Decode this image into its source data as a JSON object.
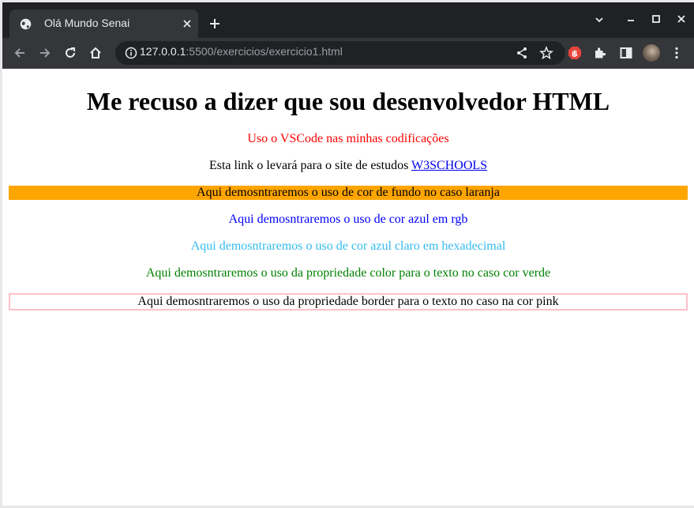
{
  "tab": {
    "title": "Olá Mundo Senai"
  },
  "address_bar": {
    "host": "127.0.0.1",
    "rest": ":5500/exercicios/exercicio1.html"
  },
  "page": {
    "heading": "Me recuso a dizer que sou desenvolvedor HTML",
    "vscode_text": "Uso o VSCode nas minhas codificações",
    "link_prefix": "Esta link o levará para o site de estudos ",
    "link_text": "W3SCHOOLS",
    "orange_text": "Aqui demosntraremos o uso de cor de fundo no caso laranja",
    "rgb_text": "Aqui demosntraremos o uso de cor azul em rgb",
    "hex_text": "Aqui demosntraremos o uso de cor azul claro em hexadecimal",
    "green_text": "Aqui demosntraremos o uso da propriedade color para o texto no caso cor verde",
    "border_text": "Aqui demosntraremos o uso da propriedade border para o texto no caso na cor pink"
  },
  "colors": {
    "red": "#ff0000",
    "rgb_blue": "#0000ff",
    "light_blue": "#33bbee",
    "green": "#008000",
    "orange": "#ffa500",
    "pink": "#ffc0cb"
  }
}
